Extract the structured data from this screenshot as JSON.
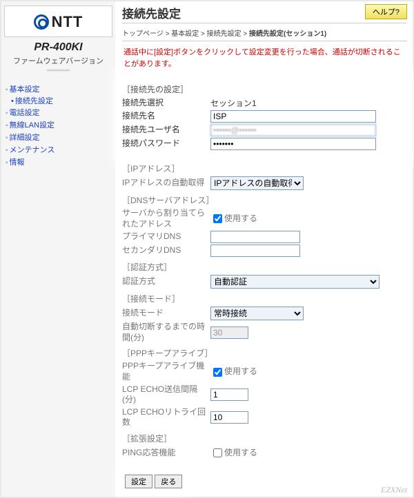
{
  "brand": "NTT",
  "model": "PR-400KI",
  "firmware_label": "ファームウェアバージョン",
  "firmware_version": "———",
  "nav": {
    "items": [
      "基本設定",
      "電話設定",
      "無線LAN設定",
      "詳細設定",
      "メンテナンス",
      "情報"
    ],
    "sub_item": "接続先設定"
  },
  "header": {
    "title": "接続先設定",
    "help": "ヘルプ?"
  },
  "breadcrumb": {
    "parts": [
      "トップページ",
      "基本設定",
      "接続先設定"
    ],
    "current": "接続先設定(セッション1)",
    "sep": " > "
  },
  "warning": "通話中に[設定]ボタンをクリックして設定変更を行った場合、通話が切断されることがあります。",
  "sections": {
    "dest": {
      "label": "［接続先の設定］",
      "select_label": "接続先選択",
      "select_value": "セッション1",
      "name_label": "接続先名",
      "name_value": "ISP",
      "user_label": "接続先ユーザ名",
      "user_value": "••••••@••••••",
      "pass_label": "接続パスワード",
      "pass_value": "•••••••"
    },
    "ip": {
      "label": "［IPアドレス］",
      "auto_label": "IPアドレスの自動取得",
      "auto_value": "IPアドレスの自動取得"
    },
    "dns": {
      "label": "［DNSサーバアドレス］",
      "assigned_label": "サーバから割り当てられたアドレス",
      "use_label": "使用する",
      "primary_label": "プライマリDNS",
      "secondary_label": "セカンダリDNS"
    },
    "auth": {
      "label": "［認証方式］",
      "method_label": "認証方式",
      "method_value": "自動認証"
    },
    "mode": {
      "label": "［接続モード］",
      "mode_label": "接続モード",
      "mode_value": "常時接続",
      "timeout_label": "自動切断するまでの時間(分)",
      "timeout_value": "30"
    },
    "keepalive": {
      "label": "［PPPキープアライブ］",
      "func_label": "PPPキープアライブ機能",
      "use_label": "使用する",
      "interval_label": "LCP ECHO送信間隔(分)",
      "interval_value": "1",
      "retry_label": "LCP ECHOリトライ回数",
      "retry_value": "10"
    },
    "ext": {
      "label": "［拡張設定］",
      "ping_label": "PING応答機能",
      "use_label": "使用する"
    }
  },
  "buttons": {
    "submit": "設定",
    "back": "戻る"
  },
  "watermark": "EZXNet"
}
